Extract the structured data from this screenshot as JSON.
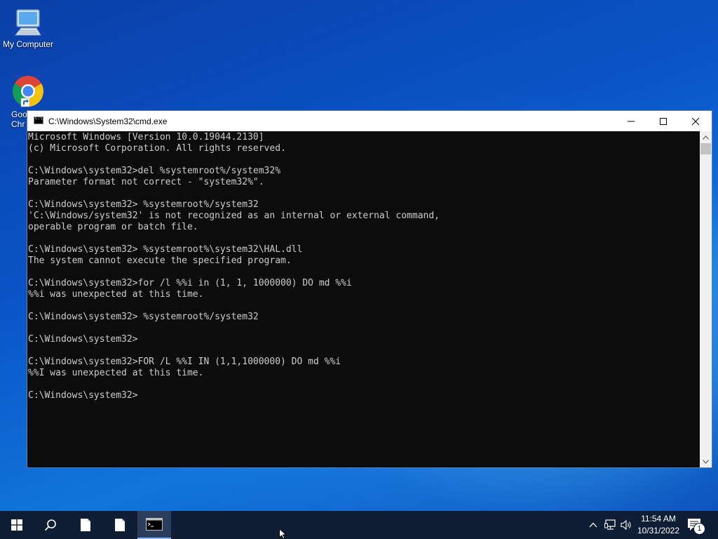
{
  "desktop": {
    "icons": [
      {
        "label": "My Computer"
      },
      {
        "label": "Google Chrome",
        "visible_label": "Goo Chr"
      }
    ]
  },
  "cmd": {
    "title": "C:\\Windows\\System32\\cmd.exe",
    "lines": [
      "Microsoft Windows [Version 10.0.19044.2130]",
      "(c) Microsoft Corporation. All rights reserved.",
      "",
      "C:\\Windows\\system32>del %systemroot%/system32%",
      "Parameter format not correct - \"system32%\".",
      "",
      "C:\\Windows\\system32> %systemroot%/system32",
      "'C:\\Windows/system32' is not recognized as an internal or external command,",
      "operable program or batch file.",
      "",
      "C:\\Windows\\system32> %systemroot%\\system32\\HAL.dll",
      "The system cannot execute the specified program.",
      "",
      "C:\\Windows\\system32>for /l %%i in (1, 1, 1000000) DO md %%i",
      "%%i was unexpected at this time.",
      "",
      "C:\\Windows\\system32> %systemroot%/system32",
      "",
      "C:\\Windows\\system32>",
      "",
      "C:\\Windows\\system32>FOR /L %%I IN (1,1,1000000) DO md %%i",
      "%%I was unexpected at this time.",
      "",
      "C:\\Windows\\system32>"
    ]
  },
  "taskbar": {
    "time": "11:54 AM",
    "date": "10/31/2022",
    "notification_count": "1"
  },
  "colors": {
    "console_bg": "#0c0c0c",
    "console_fg": "#cccccc",
    "taskbar_bg": "#0f1e34"
  }
}
